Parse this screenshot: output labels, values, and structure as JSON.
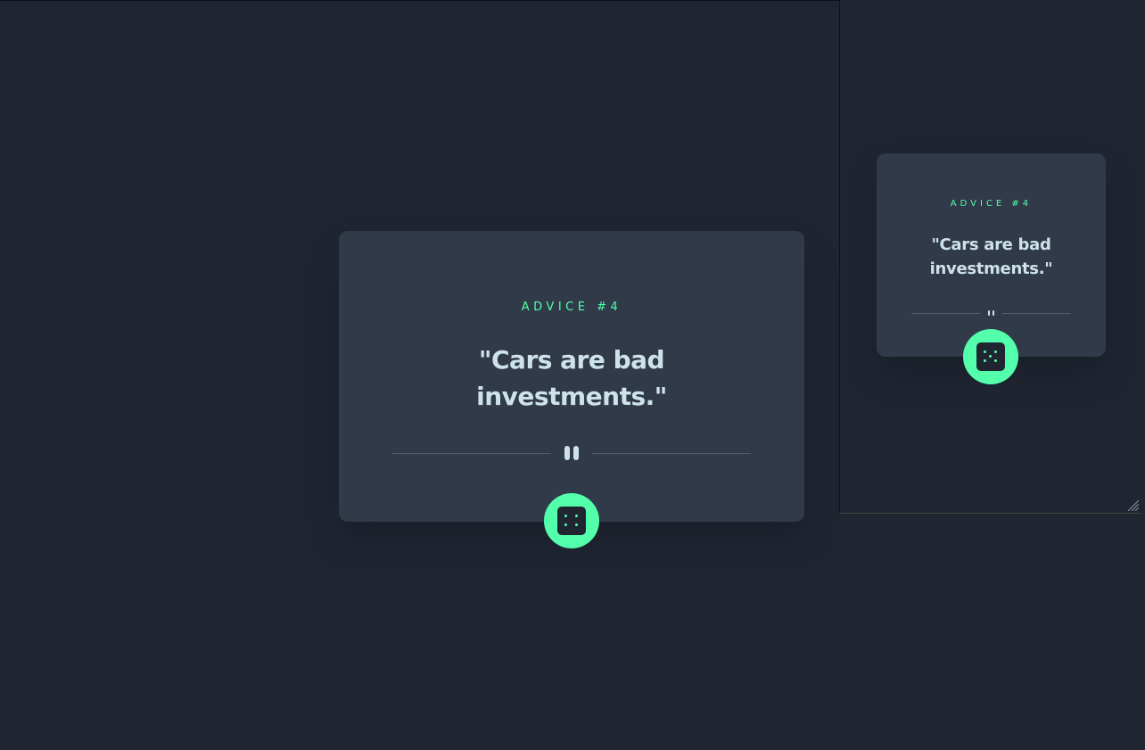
{
  "main_card": {
    "advice_label": "ADVICE #4",
    "quote": "\"Cars are bad investments.\"",
    "dice_icon": "dice-icon",
    "divider_icon": "pause-icon"
  },
  "preview_card": {
    "advice_label": "ADVICE #4",
    "quote": "\"Cars are bad investments.\"",
    "dice_icon": "dice-icon",
    "divider_icon": "pause-icon"
  },
  "colors": {
    "background": "#1f2632",
    "card": "#313a49",
    "accent": "#53ffaa",
    "text": "#cee3e9",
    "divider": "#4f5d74"
  }
}
